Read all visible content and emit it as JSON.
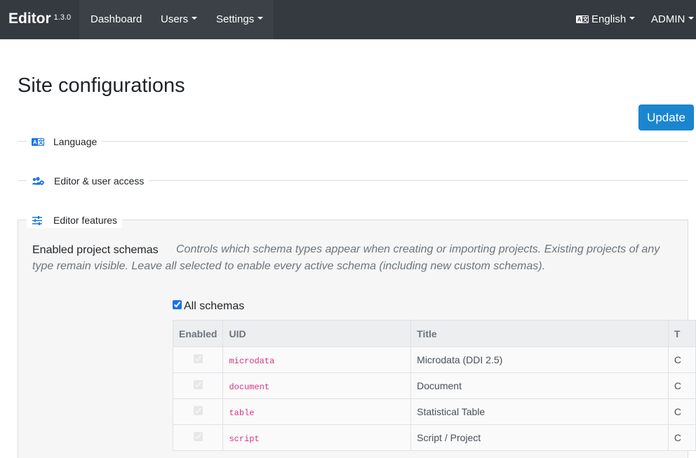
{
  "navbar": {
    "brand": "Editor",
    "version": "1.3.0",
    "links": [
      {
        "label": "Dashboard"
      },
      {
        "label": "Users"
      },
      {
        "label": "Settings"
      }
    ],
    "language_label": "English",
    "user_label": "ADMIN"
  },
  "page": {
    "title": "Site configurations",
    "update_label": "Update"
  },
  "sections": [
    {
      "label": "Language",
      "icon": "language-icon"
    },
    {
      "label": "Editor & user access",
      "icon": "users-cog-icon"
    },
    {
      "label": "Editor features",
      "icon": "sliders-icon"
    }
  ],
  "features": {
    "field_label": "Enabled project schemas",
    "help_text": "Controls which schema types appear when creating or importing projects. Existing projects of any type remain visible. Leave all selected to enable every active schema (including new custom schemas).",
    "all_schemas_label": "All schemas",
    "all_schemas_checked": true
  },
  "table": {
    "headers": [
      "Enabled",
      "UID",
      "Title",
      "T"
    ],
    "rows": [
      {
        "enabled": true,
        "uid": "microdata",
        "title": "Microdata (DDI 2.5)",
        "extra": "C"
      },
      {
        "enabled": true,
        "uid": "document",
        "title": "Document",
        "extra": "C"
      },
      {
        "enabled": true,
        "uid": "table",
        "title": "Statistical Table",
        "extra": "C"
      },
      {
        "enabled": true,
        "uid": "script",
        "title": "Script / Project",
        "extra": "C"
      }
    ]
  },
  "colors": {
    "navbar": "#343a40",
    "accent": "#1a86d0",
    "uid_text": "#d63384"
  }
}
